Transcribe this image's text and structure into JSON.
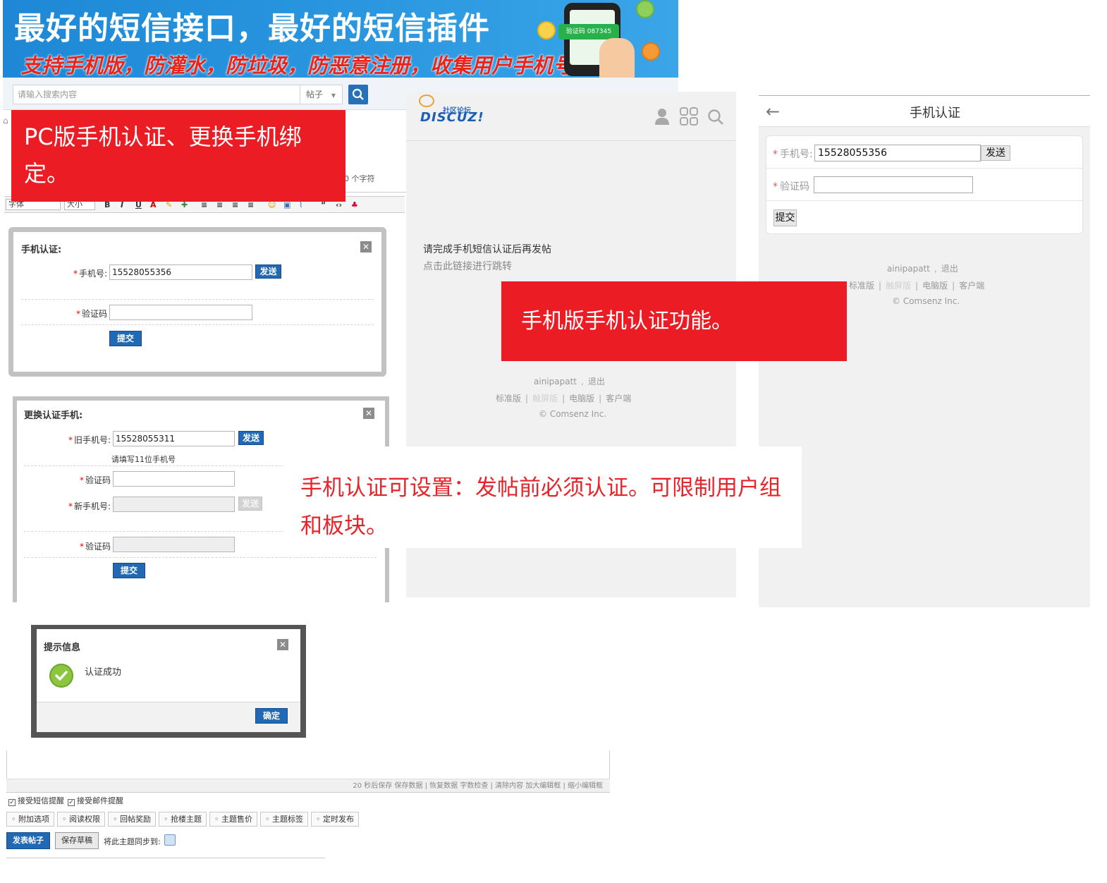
{
  "banner": {
    "title": "最好的短信接口，最好的短信插件",
    "subtitle": "支持手机版，防灌水，防垃圾，防恶意注册，收集用户手机号",
    "phone_code": "验证码 087345"
  },
  "search": {
    "placeholder": "请输入搜索内容",
    "type_label": "帖子"
  },
  "editor": {
    "char_count": "0 个字符",
    "font_select": "字体",
    "size_select": "大小"
  },
  "callouts": {
    "pc": "PC版手机认证、更换手机绑定。",
    "mobile": "手机版手机认证功能。",
    "settings": "手机认证可设置：发帖前必须认证。可限制用户组和板块。"
  },
  "dialog_verify": {
    "title": "手机认证:",
    "phone_label": "手机号:",
    "phone_value": "15528055356",
    "send_label": "发送",
    "code_label": "验证码",
    "submit_label": "提交"
  },
  "dialog_change": {
    "title": "更换认证手机:",
    "old_phone_label": "旧手机号:",
    "old_phone_value": "15528055311",
    "send_label": "发送",
    "hint": "请填写11位手机号",
    "code_label": "验证码",
    "new_phone_label": "新手机号:",
    "new_send_label": "发送",
    "code2_label": "验证码",
    "submit_label": "提交"
  },
  "mobile_post": {
    "logo_sub": "社区论坛",
    "logo_word": "DISCUZ!",
    "message": "请完成手机短信认证后再发帖",
    "link": "点击此链接进行跳转",
    "user": "ainipapatt",
    "logout": "退出",
    "links": [
      "标准版",
      "触屏版",
      "电脑版",
      "客户端"
    ],
    "copyright": "© Comsenz Inc."
  },
  "mobile_verify": {
    "title": "手机认证",
    "phone_label": "手机号:",
    "phone_value": "15528055356",
    "send_label": "发送",
    "code_label": "验证码",
    "submit_label": "提交",
    "user": "ainipapatt",
    "logout": "退出",
    "links": [
      "标准版",
      "触屏版",
      "电脑版",
      "客户端"
    ],
    "copyright": "© Comsenz Inc."
  },
  "dialog_tip": {
    "title": "提示信息",
    "message": "认证成功",
    "ok_label": "确定"
  },
  "post_editor": {
    "status": "20 秒后保存  保存数据 | 恢复数据    字数检查 | 清除内容    加大编辑框 | 缩小编辑框",
    "sms_notice": "接受短信提醒",
    "email_notice": "接受邮件提醒",
    "options": [
      "附加选项",
      "阅读权限",
      "回帖奖励",
      "抢楼主题",
      "主题售价",
      "主题标签",
      "定时发布"
    ],
    "publish_label": "发表帖子",
    "draft_label": "保存草稿",
    "sync_label": "将此主题同步到:"
  },
  "colors": {
    "accent_red": "#ec1c24",
    "button_blue": "#2269b5",
    "banner_blue": "#1e88d6"
  }
}
